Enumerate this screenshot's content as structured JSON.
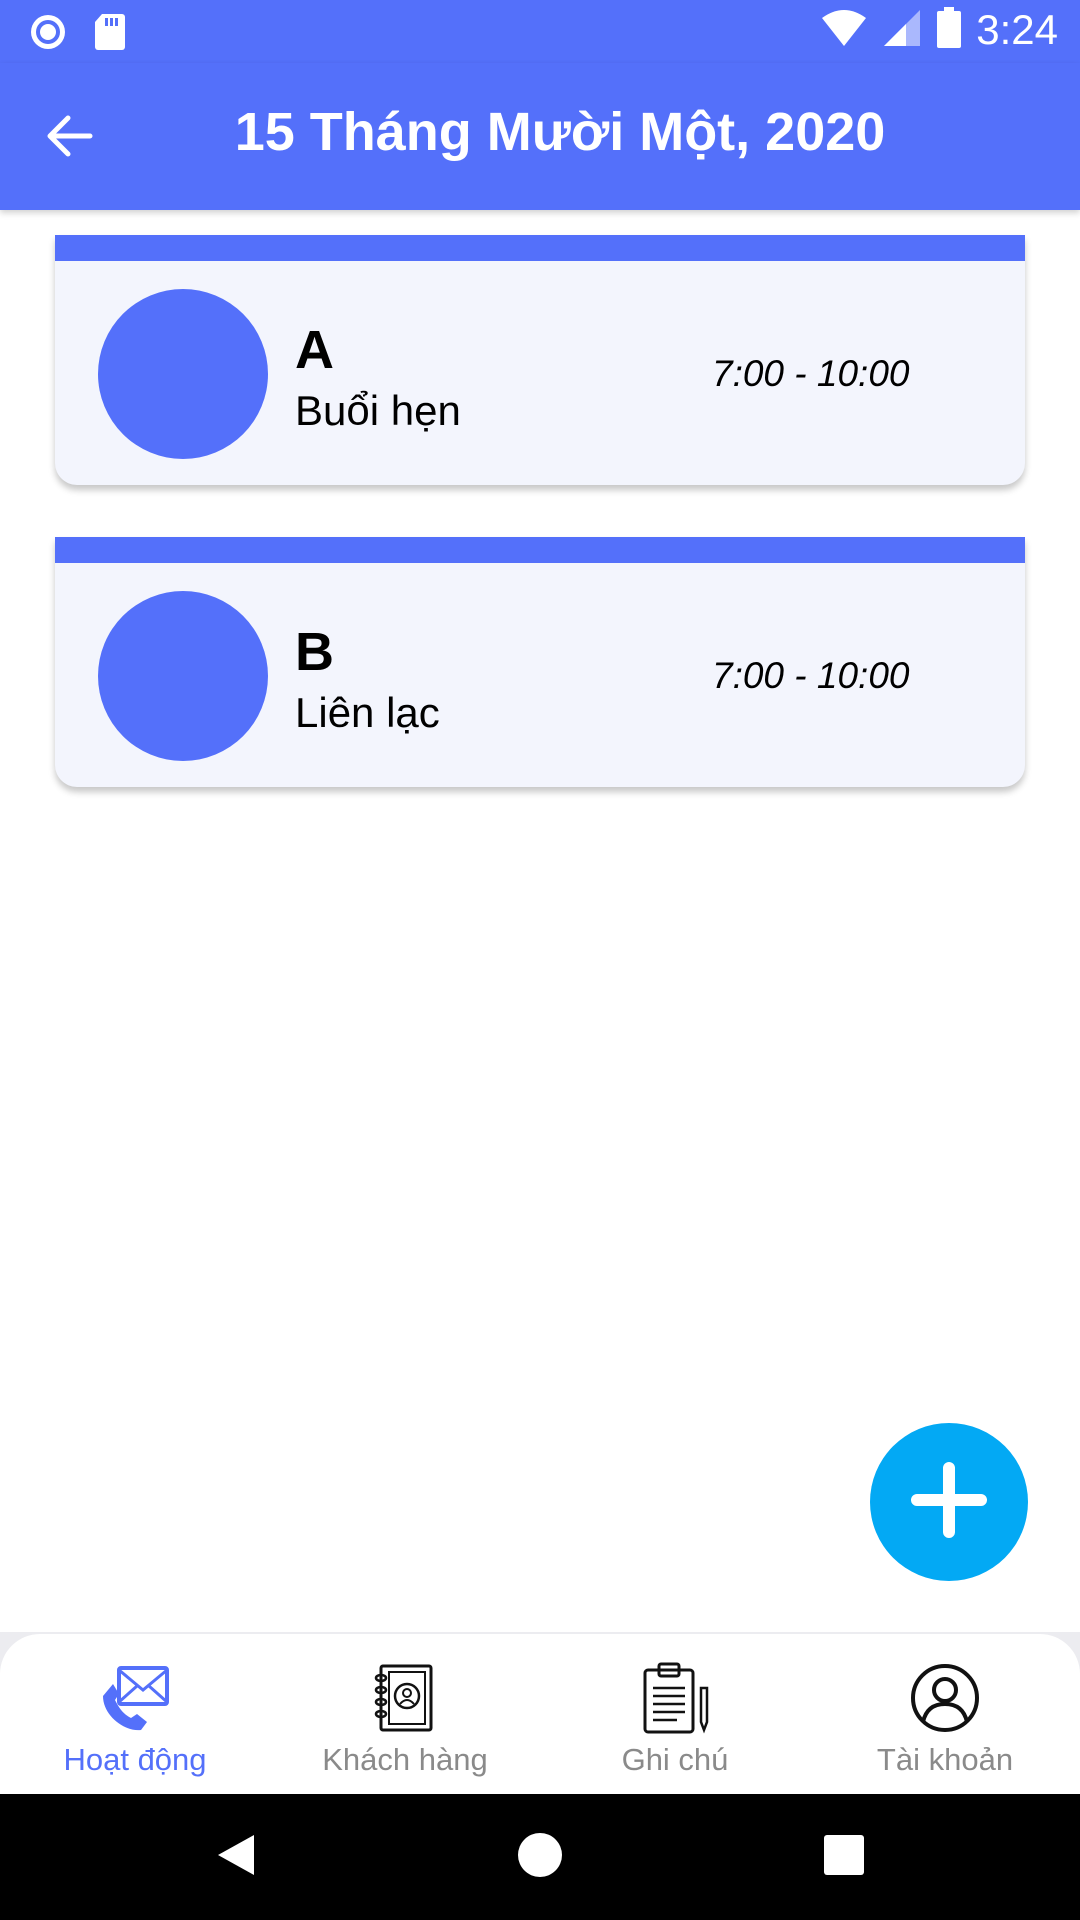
{
  "status_bar": {
    "time": "3:24",
    "left_icons": [
      "record-icon",
      "sd-card-icon"
    ],
    "right_icons": [
      "wifi-icon",
      "cell-signal-icon",
      "battery-icon"
    ]
  },
  "app_bar": {
    "title": "15 Tháng Mười Một, 2020",
    "back_icon": "arrow-left-icon"
  },
  "events": [
    {
      "name": "A",
      "type": "Buổi hẹn",
      "time": "7:00 - 10:00"
    },
    {
      "name": "B",
      "type": "Liên lạc",
      "time": "7:00 - 10:00"
    }
  ],
  "fab": {
    "icon": "plus-icon"
  },
  "bottom_nav": {
    "items": [
      {
        "label": "Hoạt động",
        "icon": "phone-mail-icon",
        "active": true
      },
      {
        "label": "Khách hàng",
        "icon": "contacts-book-icon",
        "active": false
      },
      {
        "label": "Ghi chú",
        "icon": "clipboard-note-icon",
        "active": false
      },
      {
        "label": "Tài khoản",
        "icon": "account-icon",
        "active": false
      }
    ]
  },
  "colors": {
    "primary": "#5470FA",
    "fab": "#03A9F4",
    "card_bg": "#F3F5FD",
    "inactive_nav": "#8a8a8a"
  }
}
